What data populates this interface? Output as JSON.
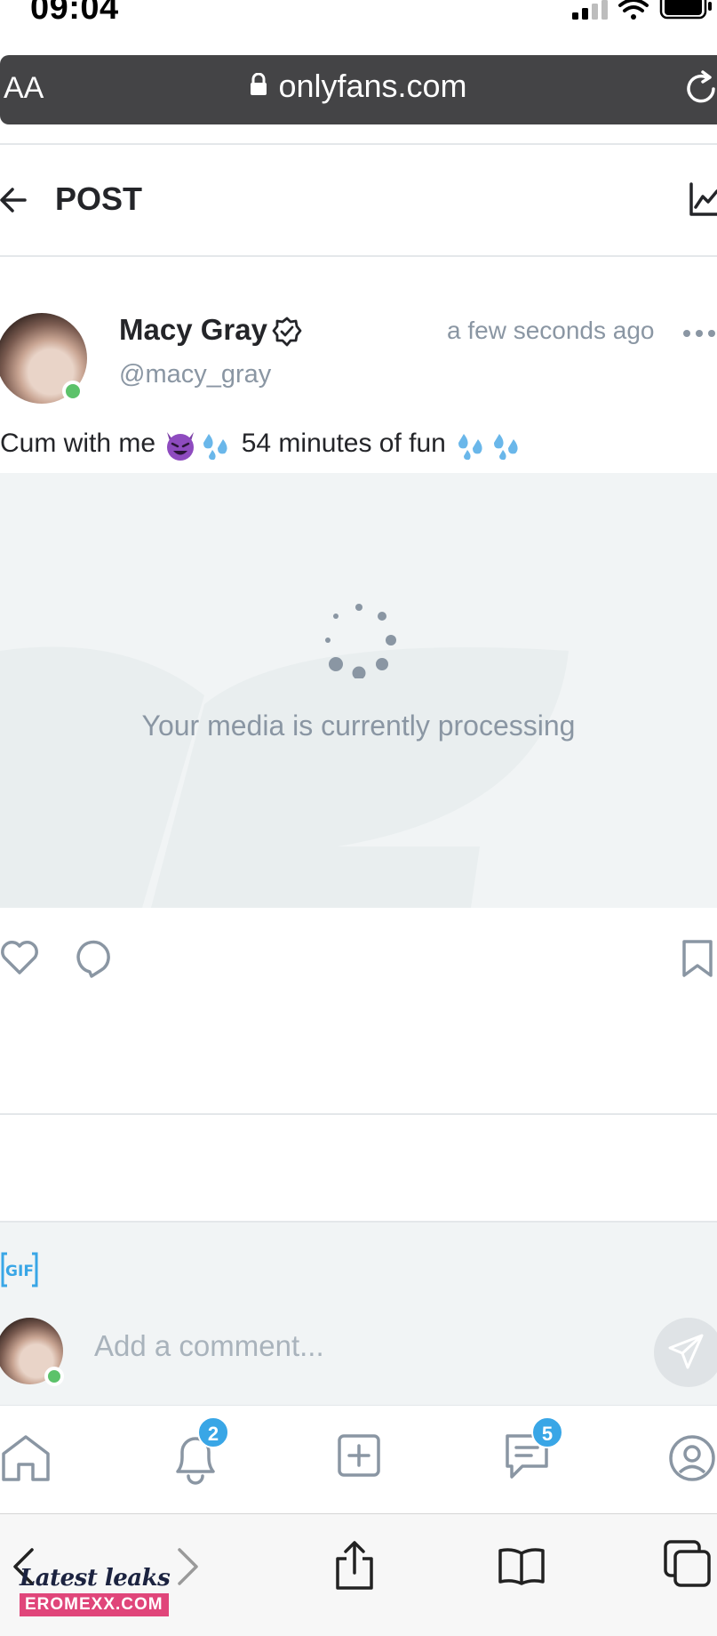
{
  "status_bar": {
    "time": "09:04"
  },
  "browser": {
    "aa_label": "AA",
    "url": "onlyfans.com"
  },
  "header": {
    "title": "POST"
  },
  "post": {
    "author_name": "Macy Gray",
    "author_handle": "@macy_gray",
    "timestamp": "a few seconds ago",
    "text_part1": "Cum with me ",
    "text_part2": " 54 minutes of fun ",
    "media_status": "Your media is currently processing"
  },
  "comment": {
    "placeholder": "Add a comment..."
  },
  "nav": {
    "notifications_badge": "2",
    "messages_badge": "5"
  },
  "watermark": {
    "line1": "Latest leaks",
    "line2": "EROMEXX.COM"
  },
  "colors": {
    "accent": "#39a6e6",
    "online": "#5cc26a",
    "muted_text": "#8a96a3",
    "media_bg": "#f1f4f5",
    "browser_bar": "#444446"
  }
}
